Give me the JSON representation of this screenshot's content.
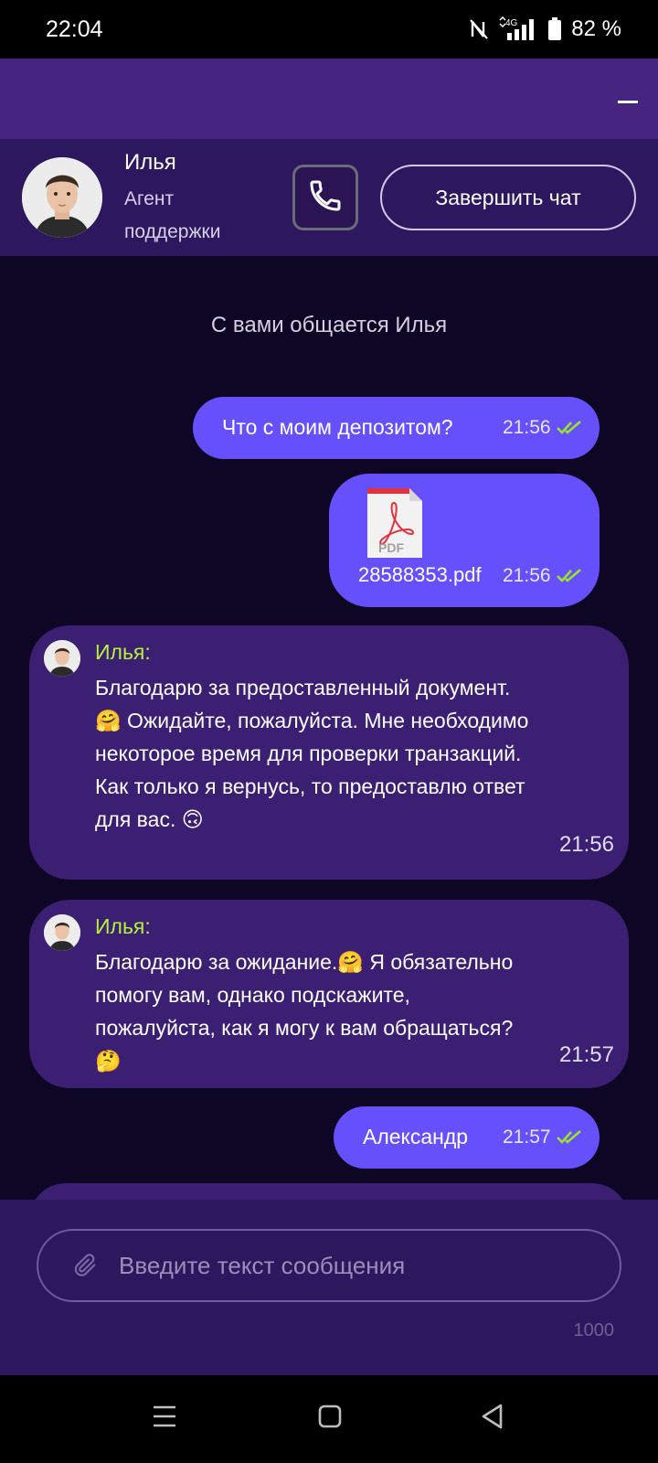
{
  "status_bar": {
    "time": "22:04",
    "network": "4G",
    "battery": "82 %",
    "icons": [
      "nfc-icon",
      "signal-icon",
      "battery-icon"
    ]
  },
  "header": {
    "agent_name": "Илья",
    "agent_role": "Агент поддержки",
    "end_chat_label": "Завершить чат",
    "call_icon": "phone-icon"
  },
  "chat": {
    "system_note": "С вами общается Илья",
    "messages": [
      {
        "type": "outgoing",
        "text": "Что с моим депозитом?",
        "time": "21:56"
      },
      {
        "type": "outgoing-file",
        "file_name": "28588353.pdf",
        "file_type": "PDF",
        "time": "21:56"
      },
      {
        "type": "incoming",
        "author": "Илья:",
        "text": "Благодарю за предоставленный документ.🤗 Ожидайте, пожалуйста. Мне необходимо некоторое время для проверки транзакций. Как только я вернусь, то предоставлю ответ для вас. 🙃",
        "time": "21:56"
      },
      {
        "type": "incoming",
        "author": "Илья:",
        "text": "Благодарю за ожидание.🤗 Я обязательно помогу вам, однако подскажите, пожалуйста, как я могу к вам обращаться?🤔",
        "time": "21:57"
      },
      {
        "type": "outgoing",
        "text": "Александр",
        "time": "21:57"
      }
    ]
  },
  "composer": {
    "placeholder": "Введите текст сообщения",
    "char_limit": "1000"
  },
  "colors": {
    "accent": "#6650fb",
    "header": "#45257f",
    "incoming_bubble": "#3a1f73",
    "author": "#b6f23b",
    "background": "#0d0624"
  }
}
